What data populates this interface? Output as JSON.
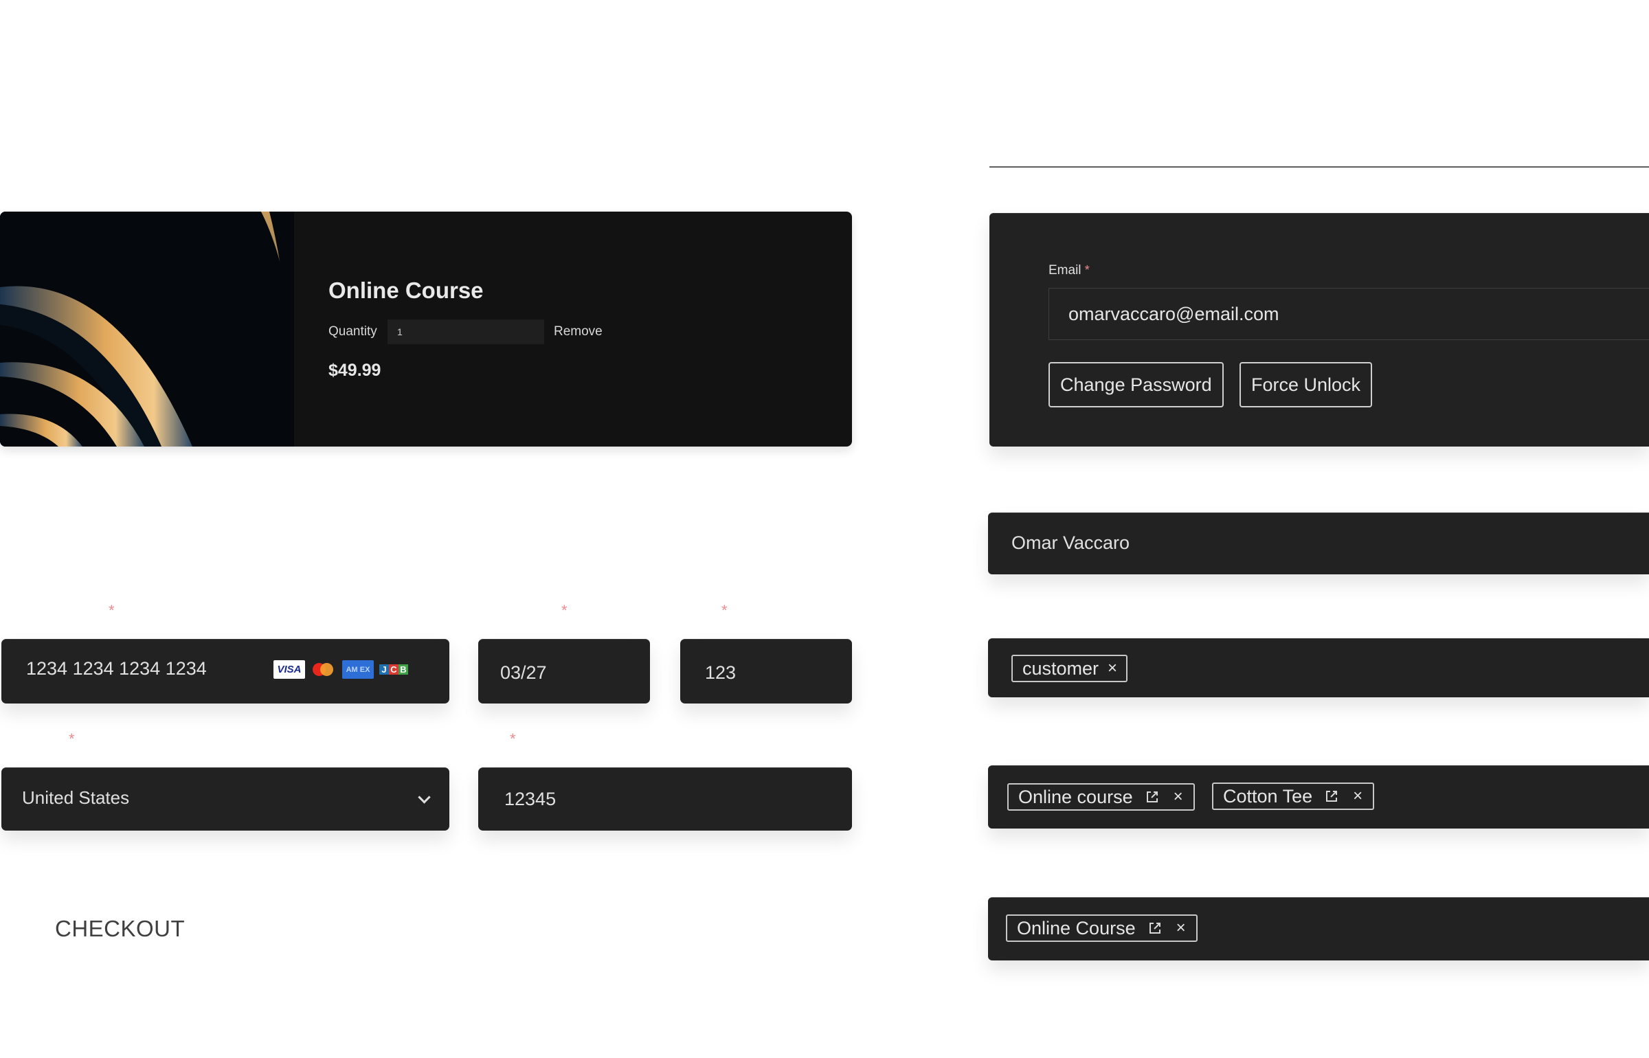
{
  "product": {
    "title": "Online Course",
    "quantity_label": "Quantity",
    "quantity_value": "1",
    "remove_label": "Remove",
    "price": "$49.99"
  },
  "payment": {
    "required_marker": "*",
    "card_number": "1234 1234 1234 1234",
    "card_brands": [
      "visa",
      "mastercard",
      "amex",
      "jcb"
    ],
    "expiry": "03/27",
    "cvc": "123",
    "country": "United States",
    "postal_code": "12345"
  },
  "checkout_heading": "CHECKOUT",
  "account": {
    "email_label": "Email",
    "required_marker": "*",
    "email_value": "omarvaccaro@email.com",
    "change_password_label": "Change Password",
    "force_unlock_label": "Force Unlock"
  },
  "profile": {
    "name": "Omar Vaccaro",
    "roles": [
      {
        "label": "customer"
      }
    ],
    "products": [
      {
        "label": "Online course"
      },
      {
        "label": "Cotton Tee"
      }
    ],
    "orders": [
      {
        "label": "Online Course"
      }
    ]
  },
  "icons": {
    "remove": "×",
    "jcb_letters": [
      "J",
      "C",
      "B"
    ],
    "amex_text": "AM EX",
    "visa_text": "VISA"
  },
  "colors": {
    "panel_bg": "#222222",
    "card_bg": "#121212",
    "required": "#f08a8f",
    "heading_text": "#3f3f3f"
  }
}
